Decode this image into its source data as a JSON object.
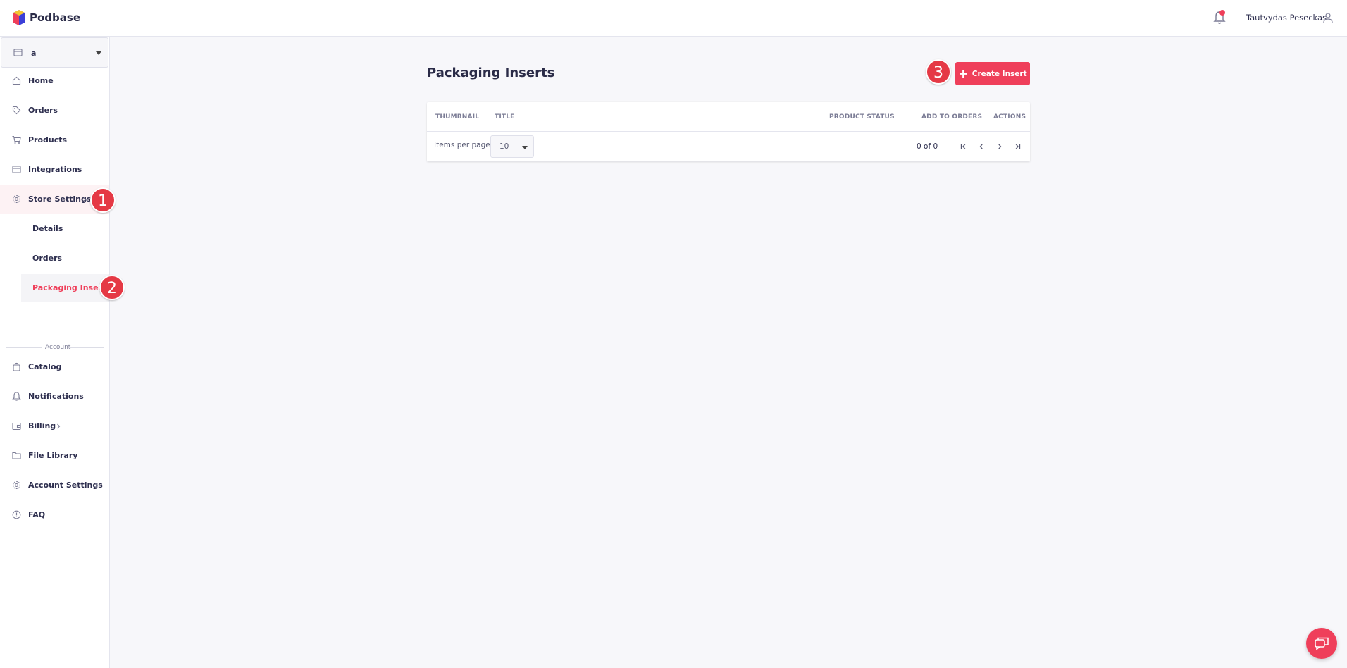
{
  "app": {
    "brand": "Podbase"
  },
  "header": {
    "user_name": "Tautvydas Peseckas",
    "has_notifications": true
  },
  "sidebar": {
    "store_selector": {
      "value": "a"
    },
    "items": [
      {
        "label": "Home",
        "icon": "home-icon"
      },
      {
        "label": "Orders",
        "icon": "tag-icon"
      },
      {
        "label": "Products",
        "icon": "cart-icon"
      },
      {
        "label": "Integrations",
        "icon": "store-icon"
      },
      {
        "label": "Store Settings",
        "icon": "gear-icon",
        "expanded": true
      }
    ],
    "sub_items": [
      {
        "label": "Details"
      },
      {
        "label": "Orders"
      },
      {
        "label": "Packaging Inserts",
        "active": true
      }
    ],
    "section_label": "Account",
    "account_items": [
      {
        "label": "Catalog",
        "icon": "bag-icon"
      },
      {
        "label": "Notifications",
        "icon": "bell-icon"
      },
      {
        "label": "Billing",
        "icon": "wallet-icon"
      },
      {
        "label": "File Library",
        "icon": "folder-icon"
      },
      {
        "label": "Account Settings",
        "icon": "gear-icon"
      },
      {
        "label": "FAQ",
        "icon": "info-icon"
      }
    ]
  },
  "steps": [
    "1",
    "2",
    "3"
  ],
  "main": {
    "title": "Packaging Inserts",
    "create_button_label": "Create Insert",
    "table": {
      "columns": [
        "THUMBNAIL",
        "TITLE",
        "PRODUCT STATUS",
        "ADD TO ORDERS",
        "ACTIONS"
      ],
      "rows": []
    },
    "pagination": {
      "items_per_page_label": "Items per page:",
      "items_per_page_value": "10",
      "range_label": "0 of 0"
    }
  },
  "colors": {
    "accent": "#ef3f5a",
    "step_marker": "#e53945",
    "text": "#2e2f4f"
  }
}
